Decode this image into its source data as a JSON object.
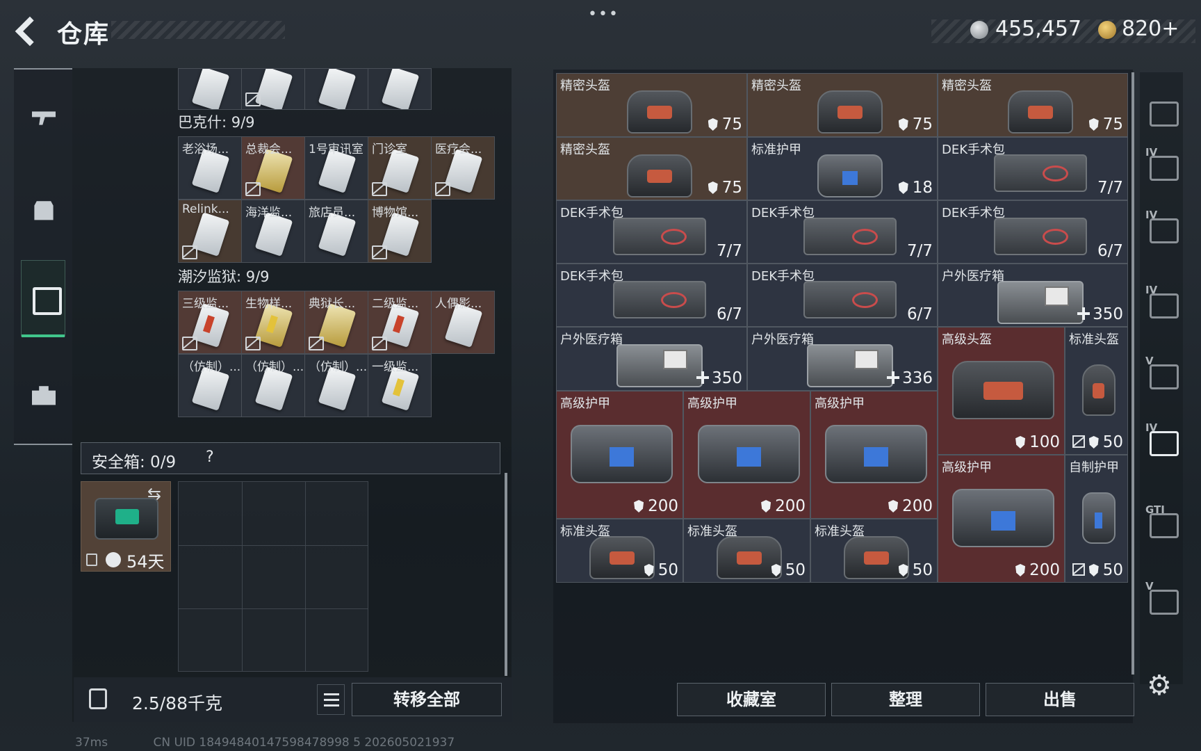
{
  "header": {
    "title": "仓库",
    "menu_dots": "•••"
  },
  "currency": {
    "silver": "455,457",
    "gold": "820",
    "gold_add": "+"
  },
  "left_tabs": [
    {
      "icon": "gun-icon"
    },
    {
      "icon": "backpack-icon"
    },
    {
      "icon": "container-icon"
    },
    {
      "icon": "briefcase-icon"
    }
  ],
  "keycards": {
    "top_row": [
      {
        "name": ""
      },
      {
        "name": ""
      },
      {
        "name": ""
      },
      {
        "name": ""
      }
    ],
    "sections": [
      {
        "title": "巴克什: 9/9",
        "items": [
          "老浴场...",
          "总裁会...",
          "1号审讯室",
          "门诊室",
          "医疗会...",
          "Relink...",
          "海洋监...",
          "旅店员...",
          "博物馆..."
        ]
      },
      {
        "title": "潮汐监狱: 9/9",
        "items": [
          "三级监...",
          "生物样...",
          "典狱长...",
          "二级监...",
          "人偶影...",
          "（仿制）...",
          "（仿制）...",
          "（仿制）...",
          "一级监..."
        ]
      }
    ]
  },
  "safe_box": {
    "label": "安全箱: 0/9",
    "help": "?",
    "days": "54天"
  },
  "bottom_left": {
    "weight": "2.5/88千克",
    "transfer_label": "转移全部"
  },
  "stash": [
    {
      "name": "精密头盔",
      "value": "75"
    },
    {
      "name": "精密头盔",
      "value": "75"
    },
    {
      "name": "精密头盔",
      "value": "75"
    },
    {
      "name": "精密头盔",
      "value": "75"
    },
    {
      "name": "标准护甲",
      "value": "18"
    },
    {
      "name": "DEK手术包",
      "value": "7/7"
    },
    {
      "name": "DEK手术包",
      "value": "7/7"
    },
    {
      "name": "DEK手术包",
      "value": "7/7"
    },
    {
      "name": "DEK手术包",
      "value": "6/7"
    },
    {
      "name": "DEK手术包",
      "value": "6/7"
    },
    {
      "name": "DEK手术包",
      "value": "6/7"
    },
    {
      "name": "户外医疗箱",
      "value": "350"
    },
    {
      "name": "户外医疗箱",
      "value": "350"
    },
    {
      "name": "户外医疗箱",
      "value": "336"
    },
    {
      "name": "高级头盔",
      "value": "100"
    },
    {
      "name": "标准头盔",
      "value": "50"
    },
    {
      "name": "高级护甲",
      "value": "200"
    },
    {
      "name": "高级护甲",
      "value": "200"
    },
    {
      "name": "高级护甲",
      "value": "200"
    },
    {
      "name": "高级护甲",
      "value": "200"
    },
    {
      "name": "自制护甲",
      "value": "50"
    },
    {
      "name": "标准头盔",
      "value": "50"
    },
    {
      "name": "标准头盔",
      "value": "50"
    },
    {
      "name": "标准头盔",
      "value": "50"
    }
  ],
  "right_buttons": {
    "collection": "收藏室",
    "sort": "整理",
    "sell": "出售"
  },
  "right_tabs": [
    "",
    "IV",
    "IV",
    "IV",
    "V",
    "IV",
    "GTI",
    "V"
  ],
  "status": {
    "ping": "37ms",
    "uid": "CN UID 18494840147598478998 5 202605021937"
  }
}
